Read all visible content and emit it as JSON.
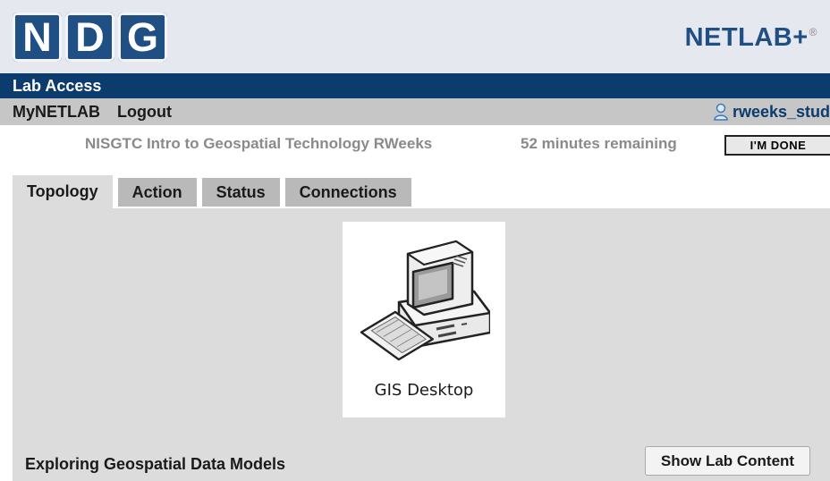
{
  "header": {
    "logo_letters": [
      "N",
      "D",
      "G"
    ],
    "brand": "NETLAB+",
    "brand_mark": "®"
  },
  "titlebar": {
    "title": "Lab Access"
  },
  "nav": {
    "items": [
      {
        "label": "MyNETLAB"
      },
      {
        "label": "Logout"
      }
    ],
    "user": {
      "icon": "user-icon",
      "name": "rweeks_stud"
    }
  },
  "lab": {
    "name": "NISGTC Intro to Geospatial Technology RWeeks",
    "time_remaining": "52 minutes remaining",
    "done_label": "I'M DONE"
  },
  "tabs": [
    {
      "label": "Topology",
      "active": true
    },
    {
      "label": "Action",
      "active": false
    },
    {
      "label": "Status",
      "active": false
    },
    {
      "label": "Connections",
      "active": false
    }
  ],
  "topology": {
    "device": {
      "icon": "desktop-computer-icon",
      "label": "GIS Desktop"
    }
  },
  "footer": {
    "lab_title": "Exploring Geospatial Data Models",
    "show_content_label": "Show Lab Content"
  },
  "colors": {
    "brand_blue": "#1f4f83",
    "titlebar_bg": "#0c3b6e",
    "navbar_bg": "#c6c6c6",
    "panel_bg": "#dcdcdc",
    "tab_bg": "#b9b9b9"
  }
}
